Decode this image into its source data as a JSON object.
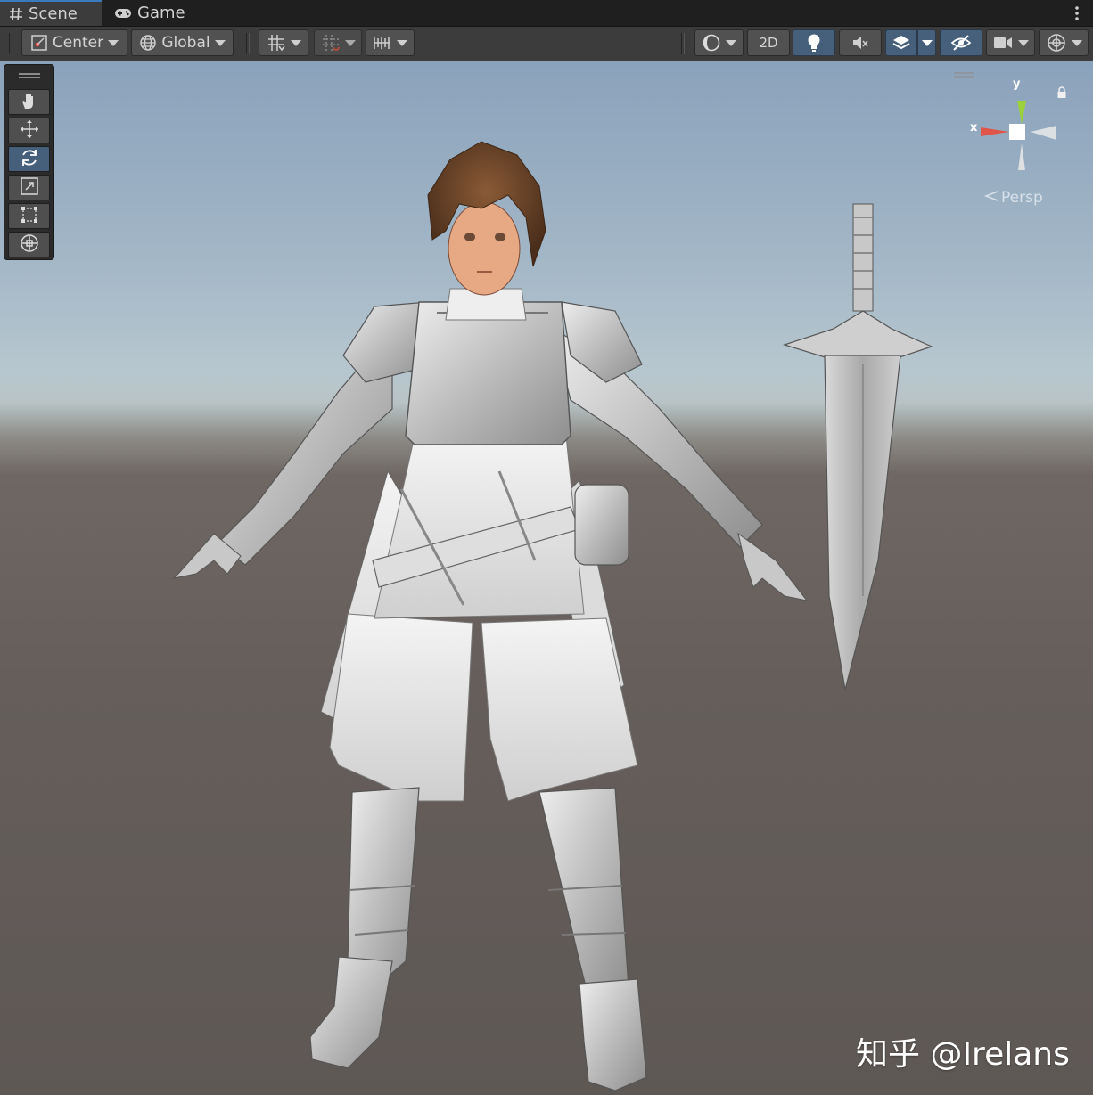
{
  "tabs": {
    "scene_label": "Scene",
    "game_label": "Game"
  },
  "toolbar": {
    "pivot_label": "Center",
    "space_label": "Global",
    "mode_2d_label": "2D"
  },
  "viewport": {
    "projection_label": "Persp",
    "axis_x": "x",
    "axis_y": "y"
  },
  "watermark": {
    "text": "知乎 @Irelans"
  },
  "colors": {
    "accent_blue": "#46607c",
    "tab_highlight": "#3a79bb",
    "gizmo_x": "#e0554a",
    "gizmo_y": "#9bd13a"
  },
  "icons": {
    "tools": [
      "hand-icon",
      "move-icon",
      "rotate-icon",
      "scale-icon",
      "rect-icon",
      "transform-icon"
    ],
    "selected_tool": "rotate-icon"
  }
}
